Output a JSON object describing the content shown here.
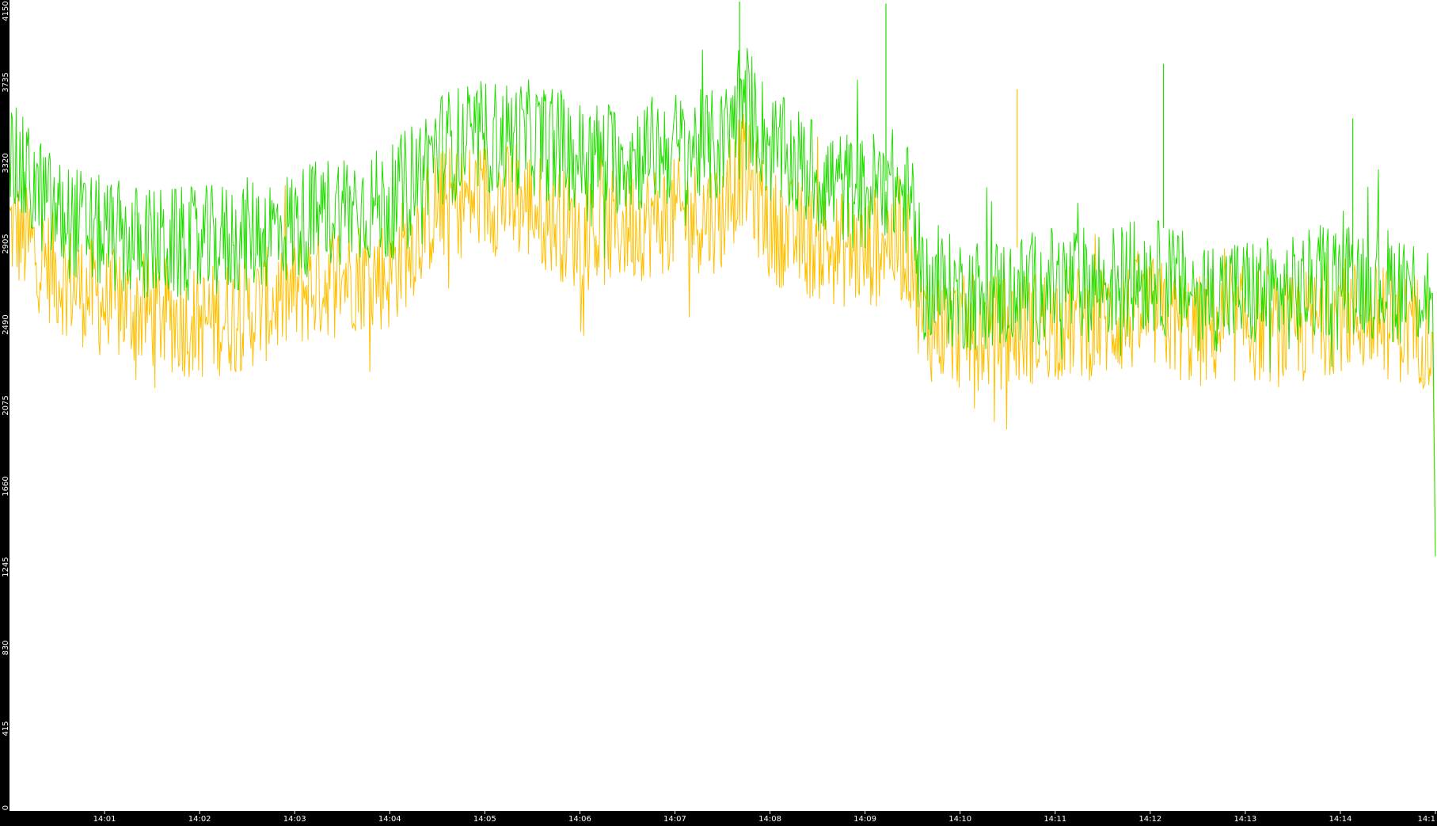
{
  "chart_data": {
    "type": "line",
    "title": "",
    "xlabel": "",
    "ylabel": "",
    "ylim": [
      0,
      4150
    ],
    "grid": false,
    "y_ticks": [
      "0",
      "415",
      "830",
      "1245",
      "1660",
      "2075",
      "2490",
      "2905",
      "3320",
      "3735",
      "4150"
    ],
    "x_ticks": [
      "14:01",
      "14:02",
      "14:03",
      "14:04",
      "14:05",
      "14:06",
      "14:07",
      "14:08",
      "14:09",
      "14:10",
      "14:11",
      "14:12",
      "14:13",
      "14:14",
      "14:1"
    ],
    "x_tick_minutes": [
      1,
      2,
      3,
      4,
      5,
      6,
      7,
      8,
      9,
      10,
      11,
      12,
      13,
      14,
      15
    ],
    "x_range_minutes": [
      0.0,
      15.0
    ],
    "series": [
      {
        "color": "#ffc000",
        "x_minutes": [
          0.0,
          0.5,
          1.0,
          1.5,
          2.0,
          2.5,
          3.0,
          3.5,
          4.0,
          4.5,
          5.0,
          5.5,
          6.0,
          6.5,
          7.0,
          7.5,
          7.7,
          8.0,
          8.5,
          9.0,
          9.2,
          9.5,
          9.6,
          10.0,
          10.5,
          11.0,
          11.5,
          12.0,
          12.5,
          13.0,
          13.5,
          14.0,
          14.5,
          14.97,
          15.0
        ],
        "values": [
          3000,
          2750,
          2600,
          2550,
          2500,
          2550,
          2650,
          2750,
          2750,
          3100,
          3150,
          3100,
          2950,
          3000,
          3050,
          3050,
          3300,
          3000,
          2900,
          2850,
          2950,
          2850,
          2500,
          2450,
          2450,
          2500,
          2500,
          2550,
          2450,
          2500,
          2450,
          2550,
          2500,
          2450,
          1300
        ]
      },
      {
        "color": "#22dd00",
        "x_minutes": [
          0.0,
          0.5,
          1.0,
          1.5,
          2.0,
          2.5,
          3.0,
          3.5,
          4.0,
          4.5,
          5.0,
          5.5,
          6.0,
          6.5,
          7.0,
          7.5,
          7.7,
          8.0,
          8.5,
          9.0,
          9.2,
          9.5,
          9.6,
          10.0,
          10.5,
          11.0,
          11.5,
          12.0,
          12.5,
          13.0,
          13.5,
          14.0,
          14.5,
          14.97,
          15.0
        ],
        "values": [
          3350,
          3050,
          2950,
          2900,
          2900,
          2950,
          3000,
          3100,
          3100,
          3400,
          3450,
          3450,
          3350,
          3350,
          3400,
          3400,
          3700,
          3400,
          3250,
          3150,
          3250,
          3100,
          2700,
          2650,
          2650,
          2700,
          2700,
          2750,
          2650,
          2650,
          2650,
          2750,
          2700,
          2650,
          1300
        ]
      }
    ],
    "spikes": [
      {
        "x_minute": 7.68,
        "value": 4150,
        "color": "#22dd00"
      },
      {
        "x_minute": 9.22,
        "value": 4140,
        "color": "#22dd00"
      },
      {
        "x_minute": 12.14,
        "value": 3830,
        "color": "#22dd00"
      },
      {
        "x_minute": 10.6,
        "value": 3700,
        "color": "#ffc000"
      },
      {
        "x_minute": 14.13,
        "value": 3550,
        "color": "#22dd00"
      }
    ]
  }
}
